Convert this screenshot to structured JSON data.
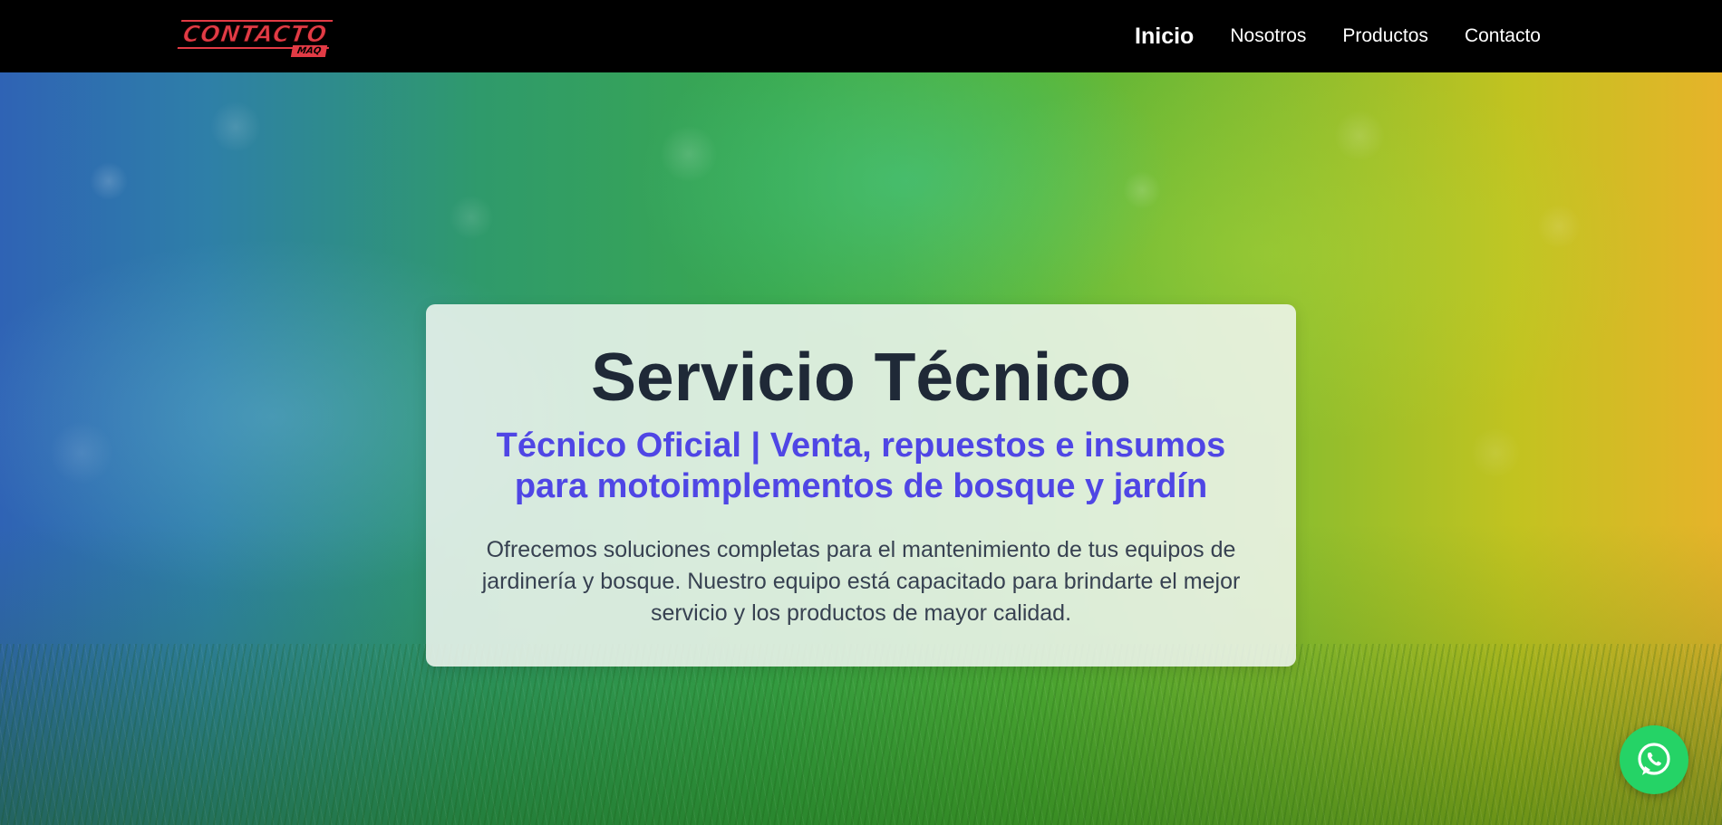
{
  "header": {
    "logo": {
      "main_text": "CONTACTO",
      "sub_text": "MAQ"
    },
    "nav": [
      {
        "label": "Inicio",
        "active": true
      },
      {
        "label": "Nosotros",
        "active": false
      },
      {
        "label": "Productos",
        "active": false
      },
      {
        "label": "Contacto",
        "active": false
      }
    ]
  },
  "hero": {
    "title": "Servicio Técnico",
    "subtitle": "Técnico Oficial | Venta, repuestos e insumos para motoimplementos de bosque y jardín",
    "description": "Ofrecemos soluciones completas para el mantenimiento de tus equipos de jardinería y bosque. Nuestro equipo está capacitado para brindarte el mejor servicio y los productos de mayor calidad."
  },
  "floating_action": {
    "icon": "whatsapp-icon",
    "color": "#25d366"
  },
  "colors": {
    "navbar_bg": "#000000",
    "nav_text": "#ffffff",
    "title": "#1f2937",
    "subtitle": "#4f46e5",
    "body_text": "#374151",
    "logo_red": "#e23b45"
  }
}
